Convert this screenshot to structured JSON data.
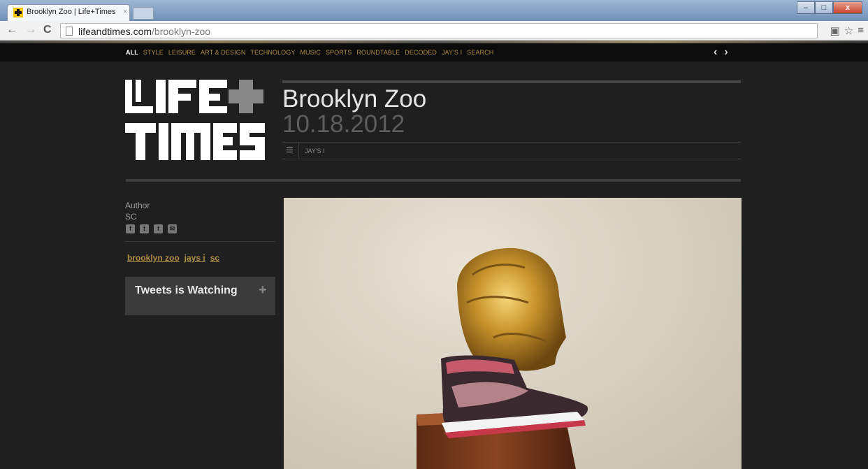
{
  "browser": {
    "tab_title": "Brooklyn Zoo | Life+Times",
    "tab_close": "×",
    "url_domain": "lifeandtimes.com",
    "url_path": "/brooklyn-zoo",
    "win_minimize": "–",
    "win_maximize": "□",
    "win_close": "x"
  },
  "nav": {
    "items": [
      "ALL",
      "STYLE",
      "LEISURE",
      "ART & DESIGN",
      "TECHNOLOGY",
      "MUSIC",
      "SPORTS",
      "ROUNDTABLE",
      "DECODED",
      "JAY'S I",
      "SEARCH"
    ],
    "active": "ALL",
    "prev": "‹",
    "next": "›"
  },
  "logo": {
    "alt": "LIFE+TIMES"
  },
  "post": {
    "title": "Brooklyn Zoo",
    "date": "10.18.2012",
    "category": "JAY'S I"
  },
  "sidebar": {
    "author_label": "Author",
    "author_name": "SC",
    "social": [
      "f",
      "t",
      "t",
      "✉"
    ],
    "tags": [
      "brooklyn zoo",
      "jays i",
      "sc"
    ],
    "tweets_title": "Tweets is Watching",
    "tweets_toggle": "+"
  },
  "colors": {
    "accent": "#b08d48",
    "background": "#1f1f1f",
    "nav_background": "#0c0c0c"
  }
}
